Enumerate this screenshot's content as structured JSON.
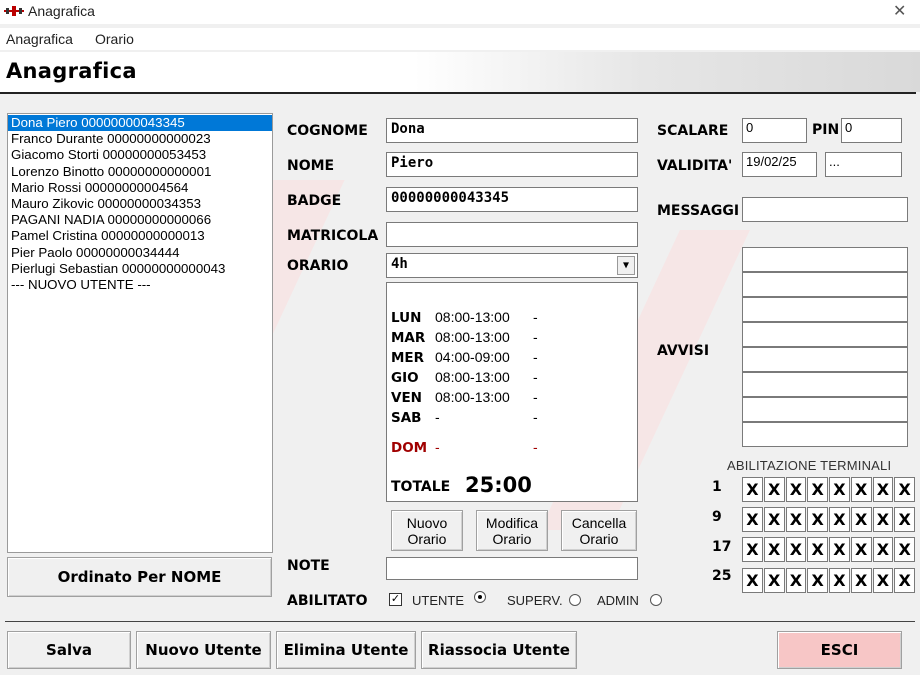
{
  "window": {
    "title": "Anagrafica",
    "close_glyph": "✕",
    "icon": "app-icon"
  },
  "menu": {
    "items": [
      "Anagrafica",
      "Orario"
    ]
  },
  "header": {
    "title": "Anagrafica"
  },
  "users": {
    "items": [
      "Dona Piero 00000000043345",
      "Franco Durante 00000000000023",
      "Giacomo Storti 00000000053453",
      "Lorenzo Binotto 00000000000001",
      "Mario Rossi 00000000004564",
      "Mauro Zikovic 00000000034353",
      "PAGANI NADIA 00000000000066",
      "Pamel Cristina 00000000000013",
      "Pier Paolo 00000000034444",
      "Pierlugi Sebastian 00000000000043",
      "--- NUOVO UTENTE ---"
    ],
    "selected_index": 0,
    "sort_button": "Ordinato Per NOME"
  },
  "form": {
    "cognome_label": "COGNOME",
    "cognome": "Dona",
    "nome_label": "NOME",
    "nome": "Piero",
    "badge_label": "BADGE",
    "badge": "00000000043345",
    "matricola_label": "MATRICOLA",
    "matricola": "",
    "orario_label": "ORARIO",
    "orario": "4h",
    "note_label": "NOTE",
    "note": "",
    "abilitato_label": "ABILITATO",
    "abilitato_checked": true,
    "abilitato_mark": "✓"
  },
  "schedule": {
    "days": [
      {
        "day": "LUN",
        "time": "08:00-13:00",
        "extra": "-"
      },
      {
        "day": "MAR",
        "time": "08:00-13:00",
        "extra": "-"
      },
      {
        "day": "MER",
        "time": "04:00-09:00",
        "extra": "-"
      },
      {
        "day": "GIO",
        "time": "08:00-13:00",
        "extra": "-"
      },
      {
        "day": "VEN",
        "time": "08:00-13:00",
        "extra": "-"
      },
      {
        "day": "SAB",
        "time": "-",
        "extra": "-"
      },
      {
        "day": "DOM",
        "time": "-",
        "extra": "-"
      }
    ],
    "total_label": "TOTALE",
    "total_value": "25:00",
    "sunday_color": "#a00000"
  },
  "schedule_buttons": {
    "nuovo": [
      "Nuovo",
      "Orario"
    ],
    "modifica": [
      "Modifica",
      "Orario"
    ],
    "cancella": [
      "Cancella",
      "Orario"
    ]
  },
  "roles": {
    "options": [
      "UTENTE",
      "SUPERV.",
      "ADMIN"
    ],
    "selected": "UTENTE"
  },
  "right": {
    "scalare_label": "SCALARE",
    "scalare": "0",
    "pin_label": "PIN",
    "pin": "0",
    "validita_label": "VALIDITA'",
    "validita": "19/02/25",
    "validita_button": "...",
    "messaggi_label": "MESSAGGI",
    "messaggi": "",
    "avvisi_label": "AVVISI",
    "avvisi": [
      "",
      "",
      "",
      "",
      "",
      "",
      "",
      ""
    ]
  },
  "terminals": {
    "title": "ABILITAZIONE TERMINALI",
    "rows": [
      {
        "start": "1",
        "cells": [
          "X",
          "X",
          "X",
          "X",
          "X",
          "X",
          "X",
          "X"
        ]
      },
      {
        "start": "9",
        "cells": [
          "X",
          "X",
          "X",
          "X",
          "X",
          "X",
          "X",
          "X"
        ]
      },
      {
        "start": "17",
        "cells": [
          "X",
          "X",
          "X",
          "X",
          "X",
          "X",
          "X",
          "X"
        ]
      },
      {
        "start": "25",
        "cells": [
          "X",
          "X",
          "X",
          "X",
          "X",
          "X",
          "X",
          "X"
        ]
      }
    ]
  },
  "footer": {
    "salva": "Salva",
    "nuovo_utente": "Nuovo Utente",
    "elimina_utente": "Elimina Utente",
    "riassocia_utente": "Riassocia Utente",
    "esci": "ESCI",
    "esci_color": "#f7c6c6"
  }
}
